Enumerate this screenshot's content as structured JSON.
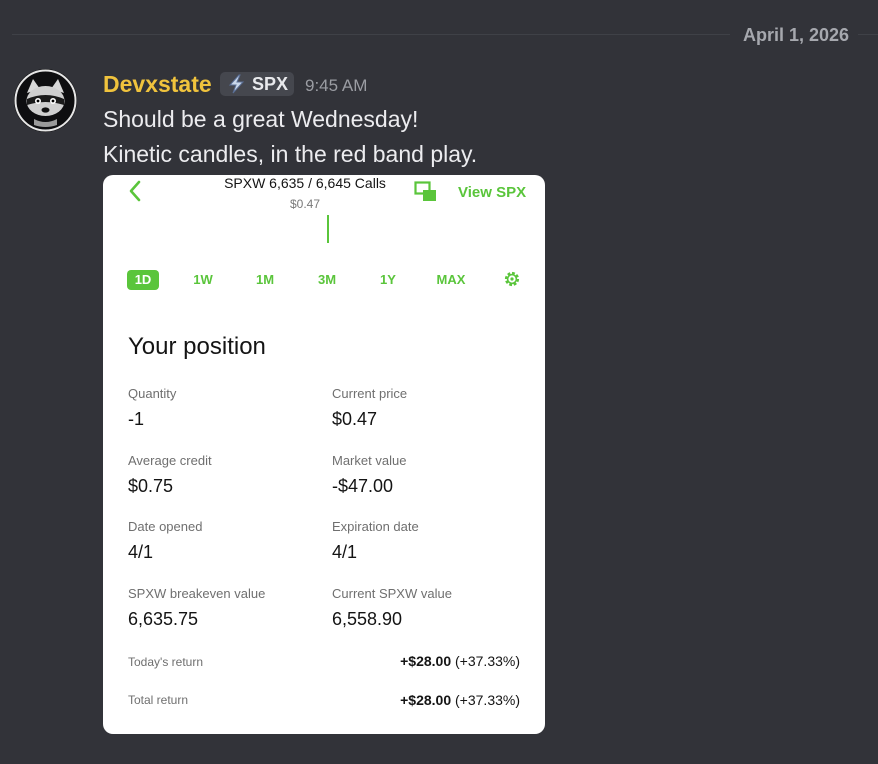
{
  "divider": {
    "date": "April 1, 2026"
  },
  "message": {
    "author": "Devxstate",
    "role_tag": "SPX",
    "timestamp": "9:45 AM",
    "lines": [
      "Should be a great Wednesday!",
      "Kinetic candles, in the red band play."
    ]
  },
  "attachment": {
    "contract_title": "SPXW 6,635 / 6,645 Calls",
    "contract_price": "$0.47",
    "view_link": "View SPX",
    "ranges": [
      "1D",
      "1W",
      "1M",
      "3M",
      "1Y",
      "MAX"
    ],
    "active_range": "1D",
    "section_title": "Your position",
    "fields": [
      {
        "label": "Quantity",
        "value": "-1"
      },
      {
        "label": "Current price",
        "value": "$0.47"
      },
      {
        "label": "Average credit",
        "value": "$0.75"
      },
      {
        "label": "Market value",
        "value": "-$47.00"
      },
      {
        "label": "Date opened",
        "value": "4/1"
      },
      {
        "label": "Expiration date",
        "value": "4/1"
      },
      {
        "label": "SPXW breakeven value",
        "value": "6,635.75"
      },
      {
        "label": "Current SPXW value",
        "value": "6,558.90"
      }
    ],
    "todays_return": {
      "label": "Today's return",
      "amount": "+$28.00",
      "percent": "(+37.33%)"
    },
    "total_return": {
      "label": "Total return",
      "amount": "+$28.00",
      "percent": "(+37.33%)"
    }
  },
  "colors": {
    "background": "#323339",
    "username": "#f0c33d",
    "accent_green": "#5ac53b"
  }
}
